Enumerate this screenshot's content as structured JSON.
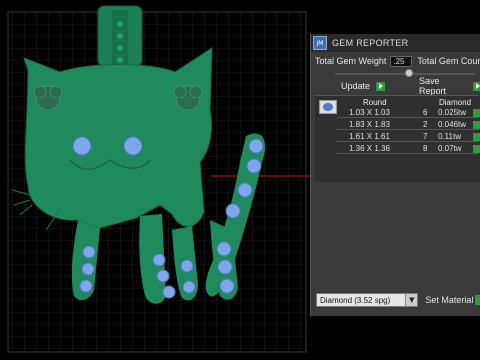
{
  "panel": {
    "logo_text": "JM",
    "title": "GEM REPORTER",
    "total_weight_label": "Total Gem Weight",
    "total_weight_value": ".25",
    "total_count_label": "Total Gem Count",
    "slider_value": 0.5,
    "update_label": "Update",
    "save_report_label": "Save Report",
    "table": {
      "col_shape": "Round",
      "col_material": "Diamond",
      "rows": [
        {
          "size": "1.03 X 1.03",
          "count": "6",
          "weight": "0.025tw"
        },
        {
          "size": "1.83 X 1.83",
          "count": "2",
          "weight": "0.046tw"
        },
        {
          "size": "1.61 X 1.61",
          "count": "7",
          "weight": "0.11tw"
        },
        {
          "size": "1.36 X 1.36",
          "count": "8",
          "weight": "0.07tw"
        }
      ]
    },
    "material_select": "Diamond    (3.52 spg)",
    "set_material_label": "Set Material"
  },
  "colors": {
    "model_green": "#1f8a5c",
    "gem_blue": "#7fa6e8",
    "grid": "#2c2c2c",
    "accent_green": "#2f9b3a"
  }
}
